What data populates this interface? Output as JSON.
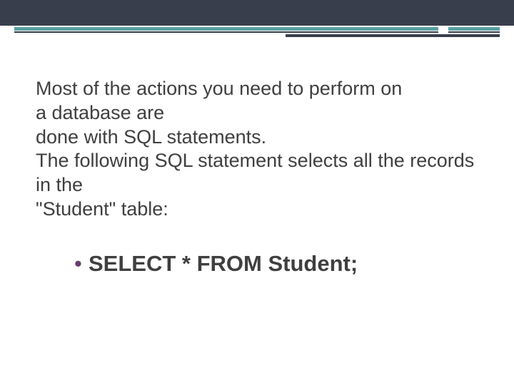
{
  "slide": {
    "body_text": "Most of the actions you need to perform on\na database are\ndone with SQL statements.\nThe following SQL statement selects all the records in the\n\"Student\" table:",
    "bullet_item": "SELECT * FROM Student;"
  },
  "theme": {
    "accent_dark": "#383e4c",
    "accent_teal": "#5a9ea3",
    "bullet_color": "#6a3c74"
  }
}
